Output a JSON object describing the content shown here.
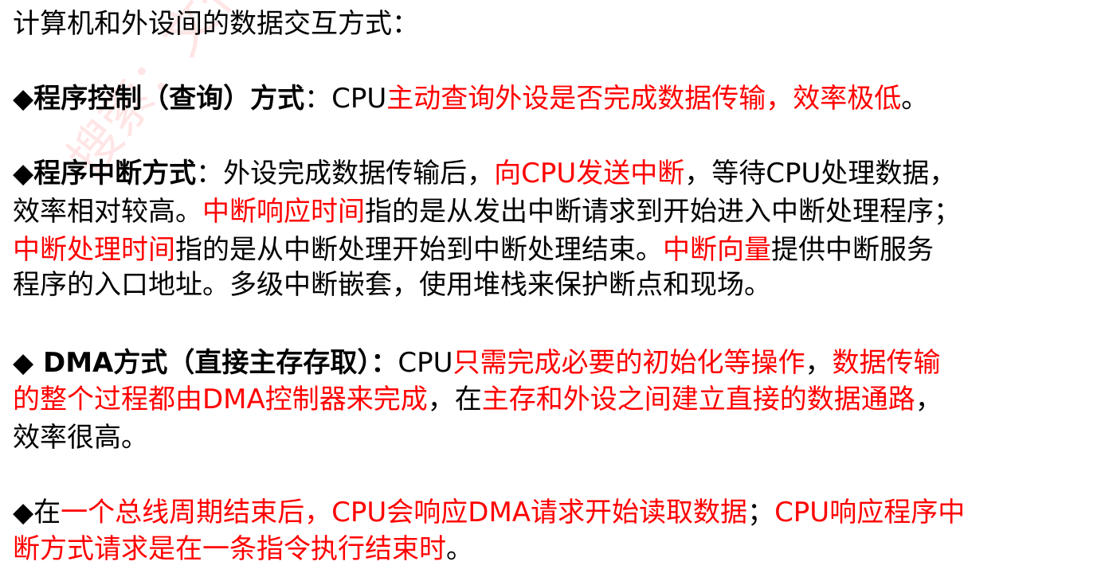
{
  "colors": {
    "accent": "#ff0000",
    "text": "#000000",
    "background": "#ffffff"
  },
  "intro": {
    "title": "计算机和外设间的数据交互方式："
  },
  "section_polling": {
    "bullet": "◆",
    "heading": "程序控制（查询）方式",
    "colon": "：",
    "t1": "CPU",
    "r1": "主动查询外设是否完成数据传输，效率极低",
    "t2": "。"
  },
  "section_interrupt": {
    "bullet": "◆",
    "heading": "程序中断方式",
    "colon": "：",
    "l1_t1": "外设完成数据传输后，",
    "l1_r1": "向CPU发送中断",
    "l1_t2": "，等待CPU处理数据，",
    "l2_t1": "效率相对较高。",
    "l2_r1": "中断响应时间",
    "l2_t2": "指的是从发出中断请求到开始进入中断处理程序；",
    "l3_r1": "中断处理时间",
    "l3_t1": "指的是从中断处理开始到中断处理结束。",
    "l3_r2": "中断向量",
    "l3_t2": "提供中断服务",
    "l4_t1": "程序的入口地址。多级中断嵌套，使用堆栈来保护断点和现场。"
  },
  "section_dma": {
    "bullet": "◆ ",
    "heading": "DMA方式（直接主存存取）",
    "colon": "：",
    "l1_t1": "CPU",
    "l1_r1": "只需完成必要的初始化等操作",
    "l1_t2": "，",
    "l1_r2": "数据传输",
    "l2_r1": "的整个过程都由DMA控制器来完成",
    "l2_t1": "，在",
    "l2_r2": "主存和外设之间建立直接的数据通路",
    "l2_t2": "，",
    "l3_t1": "效率很高。"
  },
  "section_timing": {
    "bullet": "◆",
    "l1_t1": "在",
    "l1_r1": "一个总线周期结束后，CPU会响应DMA请求开始读取数据",
    "l1_t2": "；",
    "l1_r2": "CPU响应程序中",
    "l2_r1": "断方式请求是在一条指令执行结束时",
    "l2_t1": "。"
  },
  "watermark": {
    "text": "搜索：文化课学习"
  }
}
